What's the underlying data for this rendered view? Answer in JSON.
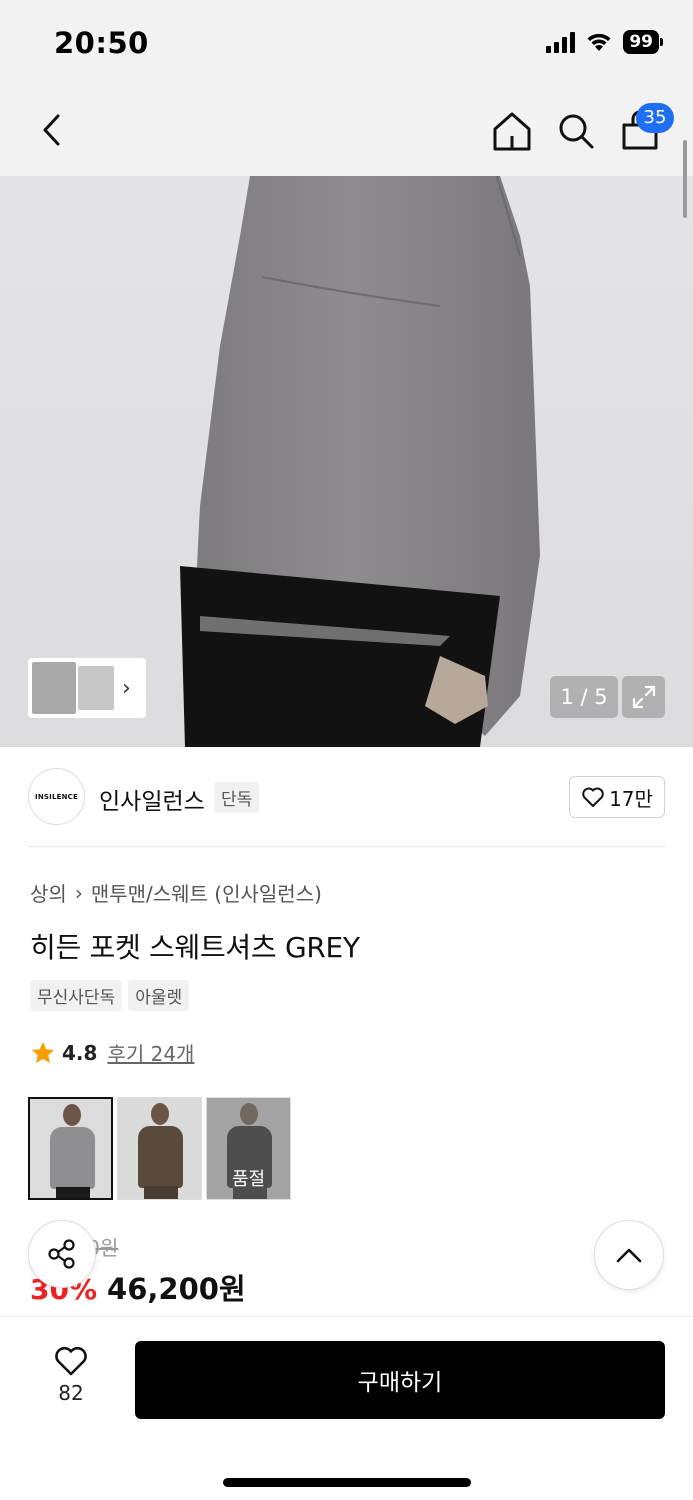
{
  "status": {
    "time": "20:50",
    "battery": "99"
  },
  "nav": {
    "cart_count": "35"
  },
  "gallery": {
    "counter": "1 / 5"
  },
  "brand": {
    "logo_text": "INSILENCE",
    "name": "인사일런스",
    "tag": "단독",
    "likes": "17만"
  },
  "product": {
    "breadcrumb": [
      "상의",
      "맨투맨/스웨트 (인사일런스)"
    ],
    "title": "히든 포켓 스웨트셔츠 GREY",
    "tags": [
      "무신사단독",
      "아울렛"
    ],
    "rating": "4.8",
    "review_link": "후기 24개",
    "color_options": [
      {
        "color": "#8f8f91",
        "selected": true
      },
      {
        "color": "#5a4a3c",
        "selected": false
      },
      {
        "color": "#1c1c1e",
        "selected": false,
        "status": "품절"
      }
    ],
    "original_price": "66,000원",
    "discount": "30%",
    "sale_price": "46,200원"
  },
  "bottom": {
    "wish_count": "82",
    "buy_label": "구매하기"
  },
  "colors": {
    "cart_badge": "#1f6ff5",
    "discount": "#e22222",
    "buy_button": "#000000"
  }
}
